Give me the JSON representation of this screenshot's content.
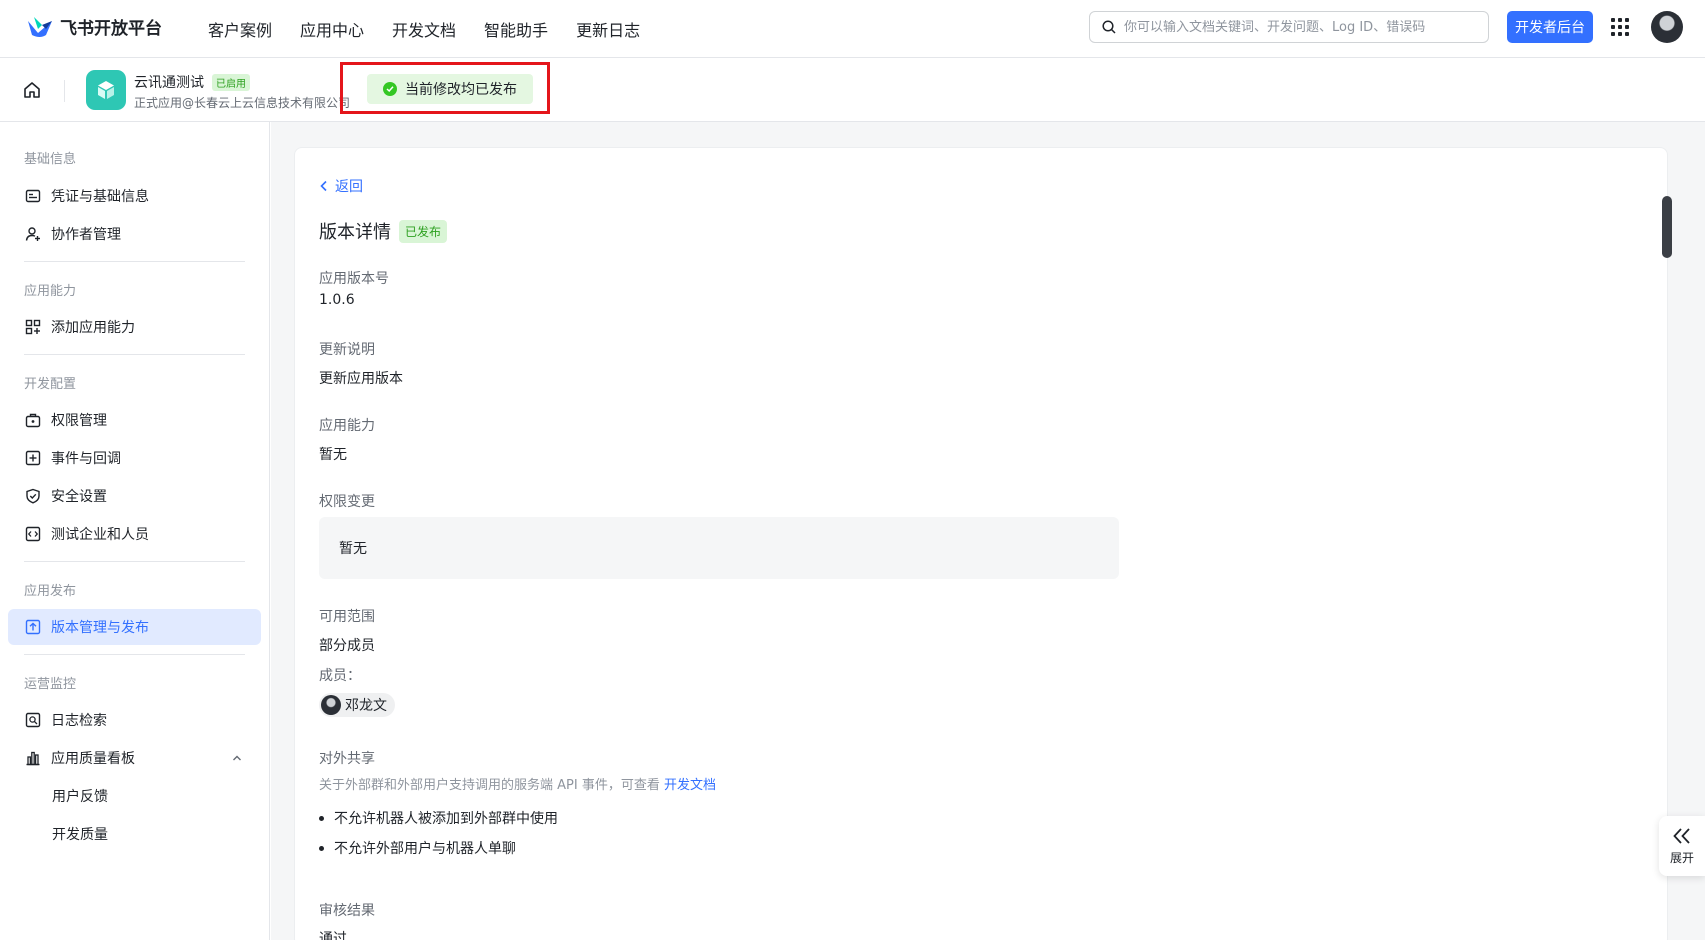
{
  "brand": {
    "name": "飞书开放平台"
  },
  "nav": [
    "客户案例",
    "应用中心",
    "开发文档",
    "智能助手",
    "更新日志"
  ],
  "search": {
    "placeholder": "你可以输入文档关键词、开发问题、Log ID、错误码"
  },
  "dev_console_label": "开发者后台",
  "app": {
    "name": "云讯通测试",
    "status_tag": "已启用",
    "subtitle": "正式应用@长春云上云信息技术有限公司"
  },
  "toast": {
    "message": "当前修改均已发布"
  },
  "sidebar": {
    "sections": [
      {
        "title": "基础信息",
        "items": [
          "凭证与基础信息",
          "协作者管理"
        ]
      },
      {
        "title": "应用能力",
        "items": [
          "添加应用能力"
        ]
      },
      {
        "title": "开发配置",
        "items": [
          "权限管理",
          "事件与回调",
          "安全设置",
          "测试企业和人员"
        ]
      },
      {
        "title": "应用发布",
        "items": [
          "版本管理与发布"
        ]
      },
      {
        "title": "运营监控",
        "items": [
          "日志检索",
          "应用质量看板",
          "用户反馈",
          "开发质量"
        ]
      }
    ],
    "active_item": "版本管理与发布"
  },
  "detail": {
    "back_label": "返回",
    "title": "版本详情",
    "status_tag": "已发布",
    "version_label": "应用版本号",
    "version_value": "1.0.6",
    "notes_label": "更新说明",
    "notes_value": "更新应用版本",
    "capability_label": "应用能力",
    "capability_value": "暂无",
    "permission_label": "权限变更",
    "permission_value": "暂无",
    "scope_label": "可用范围",
    "scope_value": "部分成员",
    "members_label": "成员：",
    "member_name": "邓龙文",
    "share_label": "对外共享",
    "share_desc": "关于外部群和外部用户支持调用的服务端 API 事件，可查看",
    "share_link": "开发文档",
    "share_items": [
      "不允许机器人被添加到外部群中使用",
      "不允许外部用户与机器人单聊"
    ],
    "review_label": "审核结果",
    "review_value": "通过"
  },
  "expand_label": "展开"
}
